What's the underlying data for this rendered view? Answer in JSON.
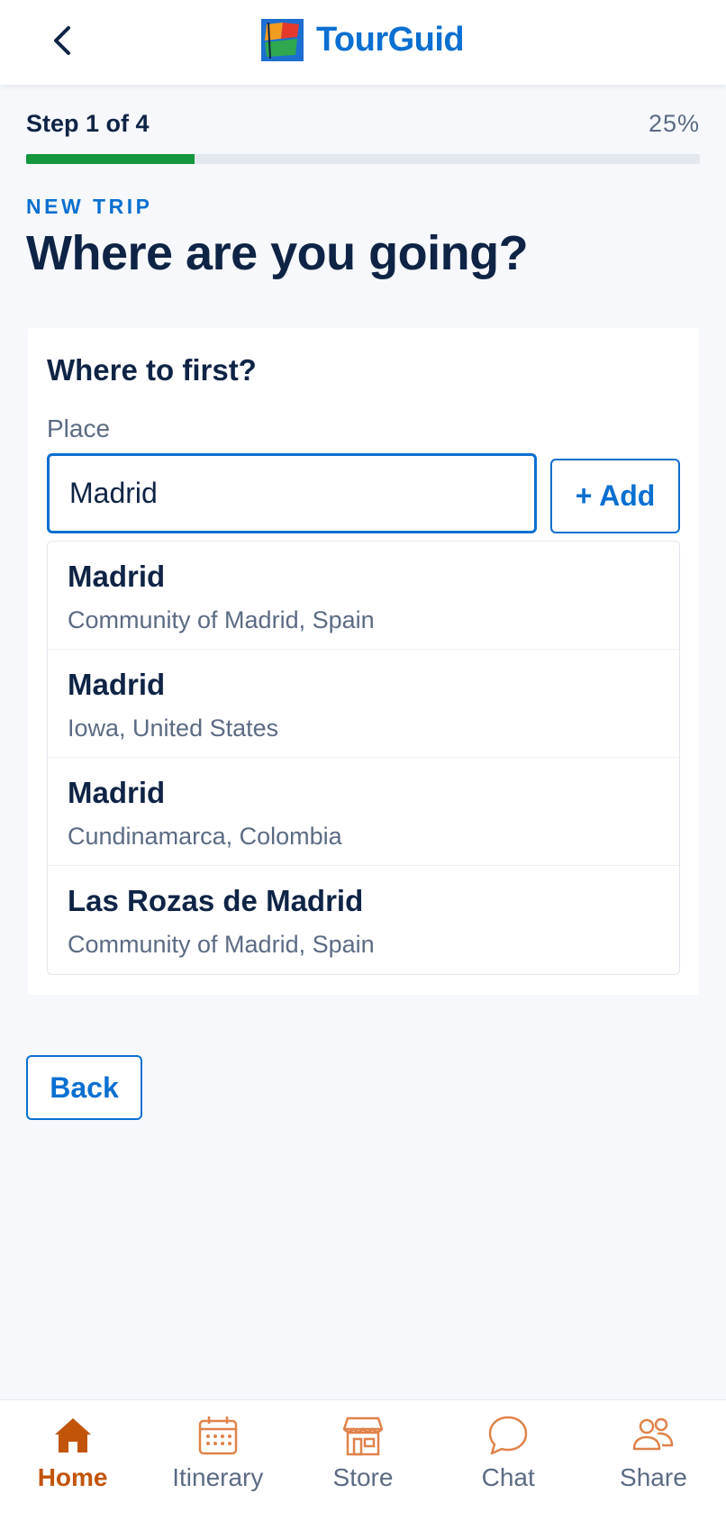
{
  "header": {
    "brand_name": "TourGuid",
    "back_icon": "chevron-left-icon",
    "logo_icon": "flag-logo-icon"
  },
  "progress": {
    "step_label": "Step 1 of 4",
    "percent_label": "25%",
    "fraction": 0.25,
    "fill_color": "#14973d"
  },
  "page": {
    "eyebrow": "NEW TRIP",
    "title": "Where are you going?"
  },
  "card": {
    "title": "Where to first?",
    "field_label": "Place",
    "input_value": "Madrid",
    "add_label": "+ Add",
    "suggestions": [
      {
        "name": "Madrid",
        "region": "Community of Madrid, Spain"
      },
      {
        "name": "Madrid",
        "region": "Iowa, United States"
      },
      {
        "name": "Madrid",
        "region": "Cundinamarca, Colombia"
      },
      {
        "name": "Las Rozas de Madrid",
        "region": "Community of Madrid, Spain"
      }
    ]
  },
  "actions": {
    "back_label": "Back"
  },
  "tabbar": {
    "items": [
      {
        "label": "Home",
        "icon": "home-icon",
        "active": true
      },
      {
        "label": "Itinerary",
        "icon": "calendar-icon",
        "active": false
      },
      {
        "label": "Store",
        "icon": "store-icon",
        "active": false
      },
      {
        "label": "Chat",
        "icon": "chat-bubble-icon",
        "active": false
      },
      {
        "label": "Share",
        "icon": "people-icon",
        "active": false
      }
    ]
  },
  "colors": {
    "accent": "#0a6fd1",
    "tab_active": "#c2540a",
    "tab_icon": "#e0824a"
  }
}
